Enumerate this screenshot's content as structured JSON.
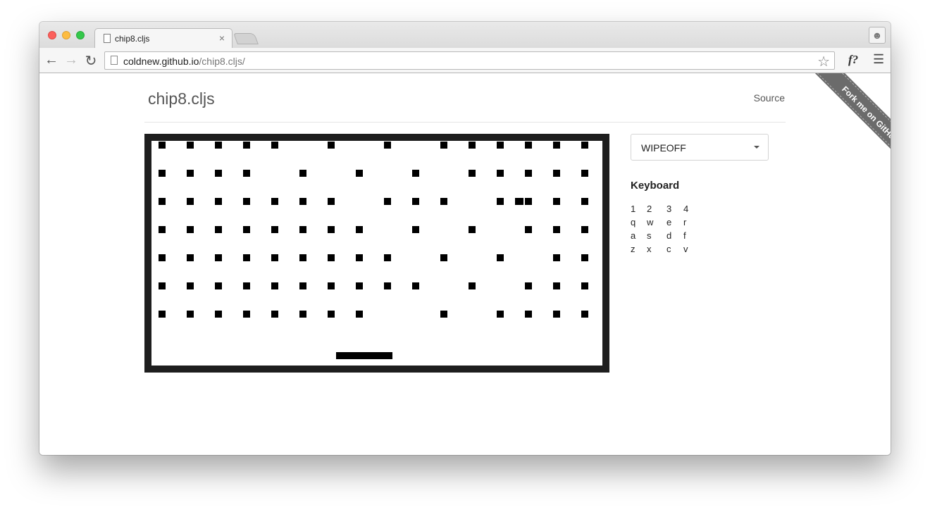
{
  "browser": {
    "tab_title": "chip8.cljs",
    "tab_close": "×",
    "url_host": "coldnew.github.io",
    "url_path": "/chip8.cljs/",
    "extension_label": "f?"
  },
  "page": {
    "title": "chip8.cljs",
    "source_link": "Source",
    "ribbon": "Fork me on GitHub"
  },
  "rom_select": {
    "value": "WIPEOFF"
  },
  "keyboard": {
    "title": "Keyboard",
    "rows": [
      [
        "1",
        "2",
        "3",
        "4"
      ],
      [
        "q",
        "w",
        "e",
        "r"
      ],
      [
        "a",
        "s",
        "d",
        "f"
      ],
      [
        "z",
        "x",
        "c",
        "v"
      ]
    ]
  },
  "game": {
    "columns": 16,
    "rows": [
      [
        1,
        1,
        1,
        1,
        1,
        0,
        1,
        0,
        1,
        0,
        1,
        1,
        1,
        1,
        1,
        1
      ],
      [
        1,
        1,
        1,
        1,
        0,
        1,
        0,
        1,
        0,
        1,
        0,
        1,
        1,
        1,
        1,
        1
      ],
      [
        1,
        1,
        1,
        1,
        1,
        1,
        1,
        0,
        1,
        1,
        1,
        0,
        1,
        1,
        1,
        1
      ],
      [
        1,
        1,
        1,
        1,
        1,
        1,
        1,
        1,
        0,
        1,
        0,
        1,
        0,
        1,
        1,
        1
      ],
      [
        1,
        1,
        1,
        1,
        1,
        1,
        1,
        1,
        1,
        0,
        1,
        0,
        1,
        0,
        1,
        1
      ],
      [
        1,
        1,
        1,
        1,
        1,
        1,
        1,
        1,
        1,
        1,
        0,
        1,
        0,
        1,
        1,
        1
      ],
      [
        1,
        1,
        1,
        1,
        1,
        1,
        1,
        1,
        0,
        0,
        1,
        0,
        1,
        1,
        1,
        1
      ]
    ],
    "paddle_position": 0.41
  }
}
